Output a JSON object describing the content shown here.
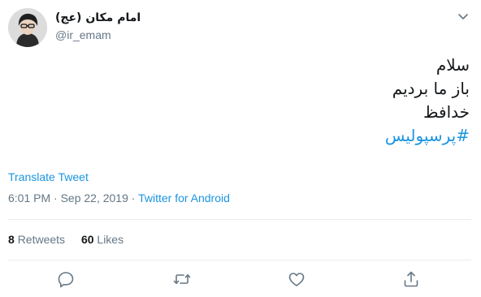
{
  "author": {
    "display_name": "امام مکان (عج)",
    "handle": "@ir_emam"
  },
  "tweet": {
    "lines": [
      "سلام",
      "باز ما بردیم",
      "خدافظ"
    ],
    "hashtag": "#پرسپولیس"
  },
  "translate_label": "Translate Tweet",
  "meta": {
    "timestamp": "6:01 PM · Sep 22, 2019",
    "separator": " · ",
    "source": "Twitter for Android"
  },
  "stats": {
    "retweets_count": "8",
    "retweets_label": "Retweets",
    "likes_count": "60",
    "likes_label": "Likes"
  },
  "icons": {
    "more": "chevron-down-icon",
    "reply": "reply-icon",
    "retweet": "retweet-icon",
    "like": "like-icon",
    "share": "share-icon"
  },
  "colors": {
    "accent": "#1b95e0",
    "muted": "#657786",
    "text": "#14171a",
    "divider": "#e6ecf0"
  }
}
